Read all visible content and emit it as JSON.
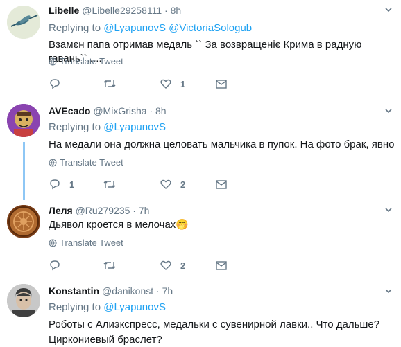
{
  "reply_prefix": "Replying to",
  "translate_label": "Translate Tweet",
  "tweets": [
    {
      "name": "Libelle",
      "handle": "@Libelle29258111",
      "dot": "·",
      "time": "8h",
      "reply_to": [
        "@LyapunovS",
        "@VictoriaSologub"
      ],
      "text": "Взамєн папа отримав медаль `` За возвращеніє Крима в радную гавань``.....",
      "counts": {
        "reply": "",
        "retweet": "",
        "like": "1"
      }
    },
    {
      "name": "AVEcado",
      "handle": "@MixGrisha",
      "dot": "·",
      "time": "8h",
      "reply_to": [
        "@LyapunovS"
      ],
      "text": "На медали она должна целовать мальчика в пупок. На фото брак, явно",
      "counts": {
        "reply": "1",
        "retweet": "",
        "like": "2"
      }
    },
    {
      "name": "Леля",
      "handle": "@Ru279235",
      "dot": "·",
      "time": "7h",
      "text": "Дьявол кроется в мелочах",
      "emoji": "🤭",
      "counts": {
        "reply": "",
        "retweet": "",
        "like": "2"
      }
    },
    {
      "name": "Konstantin",
      "handle": "@danikonst",
      "dot": "·",
      "time": "7h",
      "reply_to": [
        "@LyapunovS"
      ],
      "text": "Роботы с Алиэкспресс, медальки с сувенирной лавки.. Что дальше? Циркониевый браслет?"
    }
  ]
}
